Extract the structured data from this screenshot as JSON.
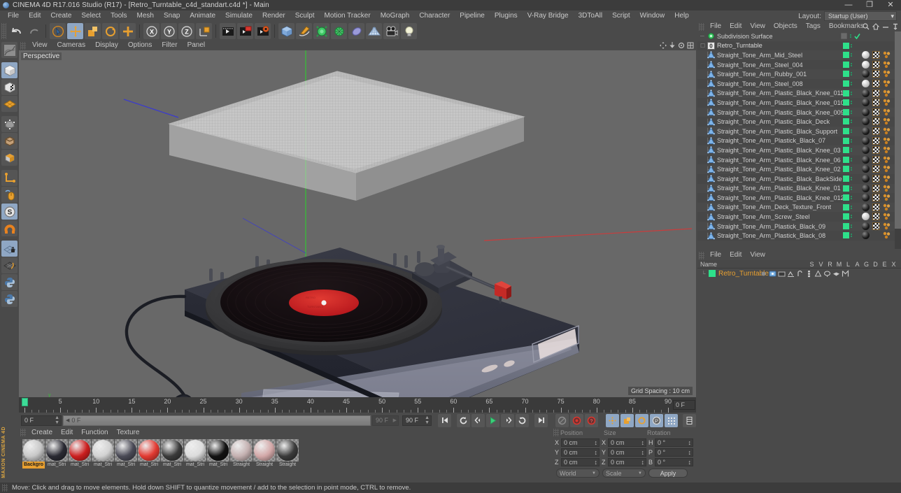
{
  "window": {
    "title": "CINEMA 4D R17.016 Studio (R17) - [Retro_Turntable_c4d_standart.c4d *] - Main",
    "minimize": "—",
    "maximize": "❐",
    "close": "✕"
  },
  "menubar": {
    "items": [
      "File",
      "Edit",
      "Create",
      "Select",
      "Tools",
      "Mesh",
      "Snap",
      "Animate",
      "Simulate",
      "Render",
      "Sculpt",
      "Motion Tracker",
      "MoGraph",
      "Character",
      "Pipeline",
      "Plugins",
      "V-Ray Bridge",
      "3DToAll",
      "Script",
      "Window",
      "Help"
    ]
  },
  "layout": {
    "label": "Layout:",
    "value": "Startup (User)",
    "arrow": "▾"
  },
  "toolbar": {
    "groups": [
      {
        "name": "undo-redo",
        "buttons": [
          {
            "name": "undo-button",
            "icon": "undo-icon",
            "state": "flat"
          },
          {
            "name": "redo-button",
            "icon": "redo-icon",
            "state": "flat"
          }
        ]
      },
      {
        "name": "tools",
        "buttons": [
          {
            "name": "live-selection-button",
            "icon": "cursor-icon",
            "state": "normal"
          },
          {
            "name": "move-tool-button",
            "icon": "move-icon",
            "state": "selected"
          },
          {
            "name": "scale-tool-button",
            "icon": "scale-icon",
            "state": "normal"
          },
          {
            "name": "rotate-tool-button",
            "icon": "rotate-icon",
            "state": "normal"
          },
          {
            "name": "add-tool-button",
            "icon": "plus-icon",
            "state": "normal"
          }
        ]
      },
      {
        "name": "axis-locks",
        "buttons": [
          {
            "name": "lock-x-button",
            "icon": "x-axis-icon",
            "state": "normal"
          },
          {
            "name": "lock-y-button",
            "icon": "y-axis-icon",
            "state": "normal"
          },
          {
            "name": "lock-z-button",
            "icon": "z-axis-icon",
            "state": "normal"
          },
          {
            "name": "world-object-axis-button",
            "icon": "world-axis-icon",
            "state": "normal"
          }
        ]
      },
      {
        "name": "render",
        "buttons": [
          {
            "name": "render-view-button",
            "icon": "render-view-icon",
            "state": "normal"
          },
          {
            "name": "render-region-button",
            "icon": "render-region-icon",
            "state": "normal"
          },
          {
            "name": "render-settings-button",
            "icon": "render-settings-icon",
            "state": "normal"
          }
        ]
      },
      {
        "name": "objects",
        "buttons": [
          {
            "name": "add-cube-button",
            "icon": "cube-icon",
            "state": "normal"
          },
          {
            "name": "add-spline-button",
            "icon": "spline-pen-icon",
            "state": "normal"
          },
          {
            "name": "add-generator-button",
            "icon": "generator-icon",
            "state": "normal"
          },
          {
            "name": "add-deformer-button",
            "icon": "deformer-icon",
            "state": "normal"
          },
          {
            "name": "add-environment-button",
            "icon": "environment-icon",
            "state": "normal"
          },
          {
            "name": "add-floor-button",
            "icon": "floor-icon",
            "state": "normal"
          },
          {
            "name": "add-camera-button",
            "icon": "camera-icon",
            "state": "normal"
          },
          {
            "name": "add-light-button",
            "icon": "light-bulb-icon",
            "state": "normal"
          }
        ]
      }
    ]
  },
  "lefttools": {
    "buttons": [
      {
        "name": "texture-axis-button",
        "icon": "texture-mode-icon",
        "state": "normal"
      },
      {
        "name": "model-mode-button",
        "icon": "model-cube-icon",
        "state": "selected"
      },
      {
        "name": "texture-mode-button",
        "icon": "texture-cube-icon",
        "state": "normal"
      },
      {
        "name": "deform-mode-button",
        "icon": "mesh-plane-icon",
        "state": "normal"
      },
      {
        "name": "points-mode-button",
        "icon": "points-cube-icon",
        "state": "normal"
      },
      {
        "name": "edges-mode-button",
        "icon": "edges-cube-icon",
        "state": "normal"
      },
      {
        "name": "polygons-mode-button",
        "icon": "polygons-cube-icon",
        "state": "normal"
      },
      {
        "name": "object-axis-button",
        "icon": "axis-icon",
        "state": "normal"
      },
      {
        "name": "enable-axis-button",
        "icon": "mouse-icon",
        "state": "normal"
      },
      {
        "name": "snap-button",
        "icon": "snap-s-icon",
        "state": "selected"
      },
      {
        "name": "magnet-button",
        "icon": "magnet-icon",
        "state": "normal"
      },
      {
        "name": "workplane-lock-button",
        "icon": "workplane-lock-icon",
        "state": "selected"
      },
      {
        "name": "workplane-button",
        "icon": "workplane-icon",
        "state": "normal"
      },
      {
        "name": "python-button-1",
        "icon": "python-icon",
        "state": "normal"
      },
      {
        "name": "python-button-2",
        "icon": "python-icon",
        "state": "normal"
      }
    ],
    "brand": "MAXON CINEMA 4D"
  },
  "viewport": {
    "menu_items": [
      "View",
      "Cameras",
      "Display",
      "Options",
      "Filter",
      "Panel"
    ],
    "label": "Perspective",
    "grid_spacing": "Grid Spacing : 10 cm",
    "nav_icons": [
      "pan-icon",
      "zoom-icon",
      "rotate-icon",
      "maximize-view-icon"
    ],
    "scene": {
      "name": "retro-turntable-3d-model",
      "background_color": "#686868",
      "body_color": "#2f3240",
      "top_plate_color": "#33343c",
      "platter_color": "#3e3e40",
      "vinyl_color": "#150e10",
      "label_color": "#c92026",
      "front_panel_color": "#6a6d7c",
      "lid_color": "#d8d8d8",
      "axis_x_color": "#d83c3c",
      "axis_y_color": "#4cd24c",
      "axis_z_color": "#4040d8"
    }
  },
  "timeline": {
    "ticks_major": [
      0,
      5,
      10,
      15,
      20,
      25,
      30,
      35,
      40,
      45,
      50,
      55,
      60,
      65,
      70,
      75,
      80,
      85,
      90
    ],
    "range_start": 0,
    "range_end": 90,
    "current_frame_label": "0 F",
    "playhead_frame": 0
  },
  "animbar": {
    "current_frame": "0 F",
    "preview_start": "0 F",
    "preview_end_ghost": "90 F",
    "end_frame": "90 F",
    "buttons": [
      {
        "name": "go-to-start-button",
        "icon": "skip-start-icon"
      },
      {
        "name": "play-backwards-button",
        "icon": "rewind-loop-icon"
      },
      {
        "name": "previous-key-button",
        "icon": "prev-key-icon"
      },
      {
        "name": "play-button",
        "icon": "play-icon"
      },
      {
        "name": "next-key-button",
        "icon": "next-key-icon"
      },
      {
        "name": "play-forwards-button",
        "icon": "forward-loop-icon"
      },
      {
        "name": "go-to-end-button",
        "icon": "skip-end-icon"
      },
      {
        "name": "record-active-objects-button",
        "icon": "record-disabled-icon"
      },
      {
        "name": "autokeying-button",
        "icon": "autokey-icon"
      },
      {
        "name": "keyframe-selection-button",
        "icon": "key-selection-icon"
      },
      {
        "name": "position-key-button",
        "icon": "position-key-icon"
      },
      {
        "name": "scale-key-button",
        "icon": "scale-key-icon"
      },
      {
        "name": "rotation-key-button",
        "icon": "rotation-key-icon"
      },
      {
        "name": "parameter-key-button",
        "icon": "param-key-icon"
      },
      {
        "name": "point-level-animation-button",
        "icon": "pla-icon"
      },
      {
        "name": "timeline-toggle-button",
        "icon": "timeline-icon"
      }
    ]
  },
  "materials": {
    "menu_items": [
      "Create",
      "Edit",
      "Function",
      "Texture"
    ],
    "items": [
      {
        "name": "Backgro",
        "color": "#c8c8c8",
        "selected": true
      },
      {
        "name": "mat_Stri",
        "color": "#2a2a33",
        "selected": false
      },
      {
        "name": "mat_Stri",
        "color": "#cc1f1f",
        "selected": false
      },
      {
        "name": "mat_Stri",
        "color": "#d2d2d2",
        "selected": false
      },
      {
        "name": "mat_Stri",
        "color": "#4a4a56",
        "selected": false
      },
      {
        "name": "mat_Stri",
        "color": "#e23a32",
        "selected": false
      },
      {
        "name": "mat_Stri",
        "color": "#3a3a3a",
        "selected": false
      },
      {
        "name": "mat_Stri",
        "color": "#dcdcdc",
        "selected": false
      },
      {
        "name": "mat_Stri",
        "color": "#121212",
        "selected": false
      },
      {
        "name": "Straight",
        "color": "#c4b0b0",
        "selected": false
      },
      {
        "name": "Straight",
        "color": "#d3a8a8",
        "selected": false
      },
      {
        "name": "Straight",
        "color": "#3a3a3a",
        "selected": false
      }
    ]
  },
  "coordinates": {
    "col_headers": [
      "Position",
      "Size",
      "Rotation"
    ],
    "rows": [
      {
        "label1": "X",
        "value1": "0 cm",
        "label2": "X",
        "value2": "0 cm",
        "label3": "H",
        "value3": "0 °"
      },
      {
        "label1": "Y",
        "value1": "0 cm",
        "label2": "Y",
        "value2": "0 cm",
        "label3": "P",
        "value3": "0 °"
      },
      {
        "label1": "Z",
        "value1": "0 cm",
        "label2": "Z",
        "value2": "0 cm",
        "label3": "B",
        "value3": "0 °"
      }
    ],
    "coord_system": "World",
    "mode": "Scale",
    "apply_label": "Apply"
  },
  "object_manager": {
    "menu_items": [
      "File",
      "Edit",
      "View",
      "Objects",
      "Tags",
      "Bookmarks"
    ],
    "header_icons": [
      "search-icon",
      "home-icon",
      "minus-icon",
      "pin-icon"
    ],
    "rows": [
      {
        "label": "Subdivision Surface",
        "indent": 0,
        "icon": "subdivision-surface-icon",
        "tags": [
          "grey-swatch",
          "check"
        ]
      },
      {
        "label": "Retro_Turntable",
        "indent": 0,
        "icon": "null-object-icon",
        "tags": []
      },
      {
        "label": "Straight_Tone_Arm_Mid_Steel",
        "indent": 1,
        "icon": "polygon-object-icon",
        "tags": [
          "mat-light",
          "checker",
          "uv"
        ]
      },
      {
        "label": "Straight_Tone_Arm_Steel_004",
        "indent": 1,
        "icon": "polygon-object-icon",
        "tags": [
          "mat-light",
          "checker",
          "uv"
        ]
      },
      {
        "label": "Straight_Tone_Arm_Rubby_001",
        "indent": 1,
        "icon": "polygon-object-icon",
        "tags": [
          "mat-dark",
          "checker",
          "uv"
        ]
      },
      {
        "label": "Straight_Tone_Arm_Steel_008",
        "indent": 1,
        "icon": "polygon-object-icon",
        "tags": [
          "mat-light",
          "checker",
          "uv"
        ]
      },
      {
        "label": "Straight_Tone_Arm_Plastic_Black_Knee_011",
        "indent": 1,
        "icon": "polygon-object-icon",
        "tags": [
          "mat-dark",
          "checker",
          "uv"
        ]
      },
      {
        "label": "Straight_Tone_Arm_Plastic_Black_Knee_010",
        "indent": 1,
        "icon": "polygon-object-icon",
        "tags": [
          "mat-dark",
          "checker",
          "uv"
        ]
      },
      {
        "label": "Straight_Tone_Arm_Plastic_Black_Knee_009",
        "indent": 1,
        "icon": "polygon-object-icon",
        "tags": [
          "mat-dark",
          "checker",
          "uv"
        ]
      },
      {
        "label": "Straight_Tone_Arm_Plastic_Black_Deck",
        "indent": 1,
        "icon": "polygon-object-icon",
        "tags": [
          "mat-dark",
          "checker",
          "uv"
        ]
      },
      {
        "label": "Straight_Tone_Arm_Plastic_Black_Support",
        "indent": 1,
        "icon": "polygon-object-icon",
        "tags": [
          "mat-dark",
          "checker",
          "uv"
        ]
      },
      {
        "label": "Straight_Tone_Arm_Plastick_Black_07",
        "indent": 1,
        "icon": "polygon-object-icon",
        "tags": [
          "mat-dark",
          "checker",
          "uv"
        ]
      },
      {
        "label": "Straight_Tone_Arm_Plastic_Black_Knee_03",
        "indent": 1,
        "icon": "polygon-object-icon",
        "tags": [
          "mat-dark",
          "checker",
          "uv"
        ]
      },
      {
        "label": "Straight_Tone_Arm_Plastic_Black_Knee_06",
        "indent": 1,
        "icon": "polygon-object-icon",
        "tags": [
          "mat-dark",
          "checker",
          "uv"
        ]
      },
      {
        "label": "Straight_Tone_Arm_Plastic_Black_Knee_02",
        "indent": 1,
        "icon": "polygon-object-icon",
        "tags": [
          "mat-dark",
          "checker",
          "uv"
        ]
      },
      {
        "label": "Straight_Tone_Arm_Plastic_Black_BackSide",
        "indent": 1,
        "icon": "polygon-object-icon",
        "tags": [
          "mat-dark",
          "checker",
          "uv"
        ]
      },
      {
        "label": "Straight_Tone_Arm_Plastic_Black_Knee_01",
        "indent": 1,
        "icon": "polygon-object-icon",
        "tags": [
          "mat-dark",
          "checker",
          "uv"
        ]
      },
      {
        "label": "Straight_Tone_Arm_Plastic_Black_Knee_012",
        "indent": 1,
        "icon": "polygon-object-icon",
        "tags": [
          "mat-dark",
          "checker",
          "uv"
        ]
      },
      {
        "label": "Straight_Tone_Arm_Deck_Texture_Front",
        "indent": 1,
        "icon": "polygon-object-icon",
        "tags": [
          "mat-dark",
          "checker",
          "uv"
        ]
      },
      {
        "label": "Straight_Tone_Arm_Screw_Steel",
        "indent": 1,
        "icon": "polygon-object-icon",
        "tags": [
          "mat-light",
          "checker",
          "uv"
        ]
      },
      {
        "label": "Straight_Tone_Arm_Plastick_Black_09",
        "indent": 1,
        "icon": "polygon-object-icon",
        "tags": [
          "mat-dark",
          "checker",
          "uv"
        ]
      },
      {
        "label": "Straight_Tone_Arm_Plastick_Black_08",
        "indent": 1,
        "icon": "polygon-object-icon",
        "tags": [
          "mat-dark",
          "uv"
        ]
      }
    ]
  },
  "layer_manager": {
    "menu_items": [
      "File",
      "Edit",
      "View"
    ],
    "name_header": "Name",
    "columns": [
      "S",
      "V",
      "R",
      "M",
      "L",
      "A",
      "G",
      "D",
      "E",
      "X"
    ],
    "rows": [
      {
        "label": "Retro_Turntable",
        "color": "#2ee08a",
        "text_color": "#e8a030"
      }
    ]
  },
  "statusbar": {
    "message": "Move: Click and drag to move elements. Hold down SHIFT to quantize movement / add to the selection in point mode, CTRL to remove."
  }
}
